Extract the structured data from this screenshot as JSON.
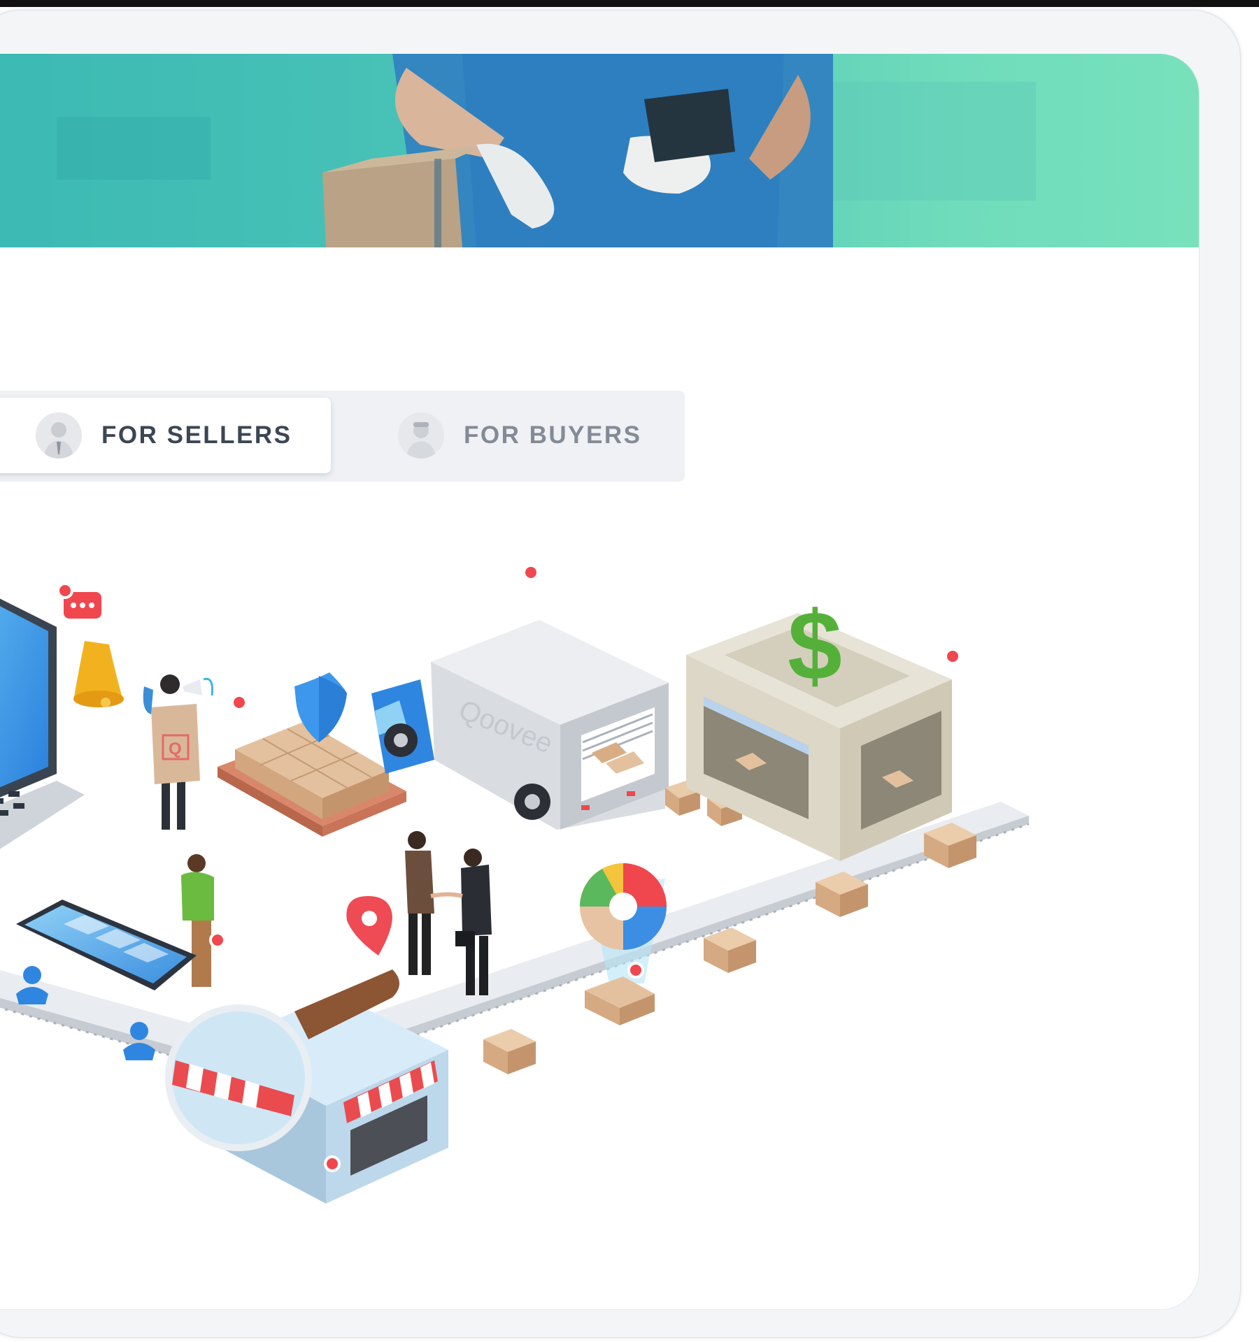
{
  "tabs": {
    "sellers": {
      "label": "FOR SELLERS",
      "active": true
    },
    "buyers": {
      "label": "FOR BUYERS",
      "active": false
    }
  },
  "illustration": {
    "truck_brand": "Qoovee",
    "sign_letter": "Q",
    "currency_symbol": "$"
  },
  "colors": {
    "hero_start": "#3bb9b3",
    "hero_end": "#78e1bc",
    "marker": "#f0474f",
    "tab_text_active": "#3c4654",
    "tab_text_inactive": "#838b96"
  }
}
